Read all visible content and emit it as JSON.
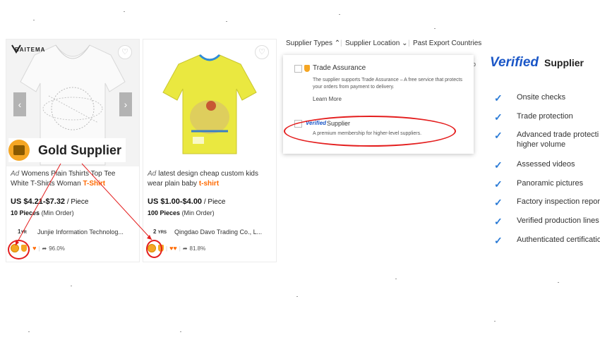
{
  "cards": [
    {
      "brand": "BAITEMA",
      "ad_tag": "Ad",
      "title": "Womens Plain Tshirts Top Tee White T-Shirts Woman",
      "keyword": "T-Shirt",
      "price": "US $4.21-$7.32",
      "price_unit": "/ Piece",
      "moq_qty": "10 Pieces",
      "moq_label": "(Min Order)",
      "years": "1",
      "years_unit": "YR",
      "company": "Junjie Information Technolog...",
      "rate": "96.0%"
    },
    {
      "ad_tag": "Ad",
      "title": "latest design cheap custom kids wear plain baby",
      "keyword": "t-shirt",
      "price": "US $1.00-$4.00",
      "price_unit": "/ Piece",
      "moq_qty": "100 Pieces",
      "moq_label": "(Min Order)",
      "years": "2",
      "years_unit": "YRS",
      "company": "Qingdao Davo Trading Co., L...",
      "rate": "81.8%"
    }
  ],
  "gold_supplier": {
    "label": "Gold Supplier"
  },
  "filters": {
    "supplier_types": "Supplier Types",
    "supplier_location": "Supplier Location",
    "past_export": "Past Export Countries"
  },
  "dropdown": {
    "trade_assurance": "Trade Assurance",
    "trade_assurance_desc": "The supplier supports Trade Assurance – A free service that protects your orders from payment to delivery.",
    "learn_more": "Learn More",
    "verified": "Verified",
    "supplier": "Supplier",
    "verified_desc": "A premium membership for higher-level suppliers."
  },
  "verified_panel": {
    "verified_word": "Verified",
    "supplier_word": "Supplier",
    "features": [
      "Onsite checks",
      "Trade protection",
      "Advanced trade protecti",
      "Assessed videos",
      "Panoramic pictures",
      "Factory inspection repor",
      "Verified production lines",
      "Authenticated certificatio"
    ],
    "feature_sub": "higher volume"
  },
  "colors": {
    "accent_orange": "#ff6a00",
    "gold": "#f5a623",
    "verified_blue": "#1a56c7",
    "check_blue": "#2b7bd6",
    "annotation_red": "#e41e1e"
  }
}
